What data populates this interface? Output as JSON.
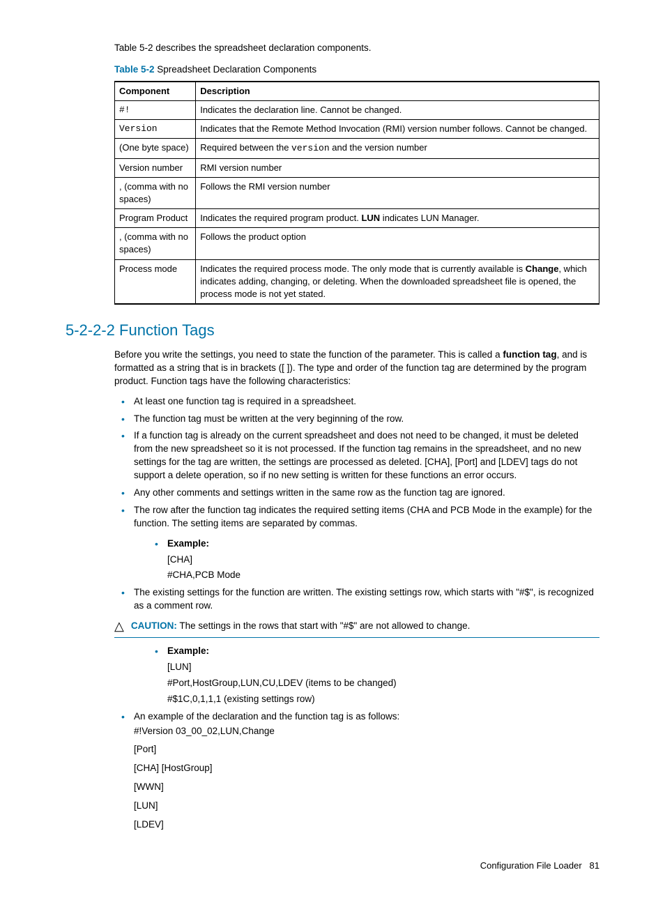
{
  "intro": "Table 5-2 describes the spreadsheet declaration components.",
  "tableCaption": {
    "ref": "Table 5-2",
    "title": " Spreadsheet Declaration Components"
  },
  "table": {
    "headers": [
      "Component",
      "Description"
    ],
    "rows": [
      {
        "c": "#!",
        "cMono": true,
        "d": "Indicates the declaration line. Cannot be changed."
      },
      {
        "c": "Version",
        "cMono": true,
        "d": "Indicates that the Remote Method Invocation (RMI) version number follows. Cannot be changed."
      },
      {
        "c": "(One byte space)",
        "dPre": "Required between the ",
        "dMono": "version",
        "dPost": " and the version number"
      },
      {
        "c": "Version number",
        "d": "RMI version number"
      },
      {
        "c": ", (comma with no spaces)",
        "d": "Follows the RMI version number"
      },
      {
        "c": "Program Product",
        "dPre": "Indicates the required program product. ",
        "dBold": "LUN",
        "dPost": " indicates LUN Manager."
      },
      {
        "c": ", (comma with no spaces)",
        "d": "Follows the product option"
      },
      {
        "c": "Process mode",
        "dPre": "Indicates the required process mode. The only mode that is currently available is ",
        "dBold": "Change",
        "dPost": ", which indicates adding, changing, or deleting. When the downloaded spreadsheet file is opened, the process mode is not yet stated."
      }
    ]
  },
  "section": {
    "heading": "5-2-2-2 Function Tags",
    "paraPre": "Before you write the settings, you need to state the function of the parameter. This is called a ",
    "paraBold": "function tag",
    "paraPost": ", and is formatted as a string that is in brackets ([ ]). The type and order of the function tag are determined by the program product. Function tags have the following characteristics:",
    "bullets1": [
      "At least one function tag is required in a spreadsheet.",
      "The function tag must be written at the very beginning of the row.",
      "If a function tag is already on the current spreadsheet and does not need to be changed, it must be deleted from the new spreadsheet so it is not processed. If the function tag remains in the spreadsheet, and no new settings for the tag are written, the settings are processed as deleted. [CHA], [Port] and [LDEV] tags do not support a delete operation, so if no new setting is written for these functions an error occurs.",
      "Any other comments and settings written in the same row as the function tag are ignored.",
      "The row after the function tag indicates the required setting items (CHA and PCB Mode in the example) for the function. The setting items are separated by commas."
    ],
    "example1": {
      "label": "Example:",
      "lines": [
        "[CHA]",
        "#CHA,PCB Mode"
      ]
    },
    "bullet2": "The existing settings for the function are written. The existing settings row, which starts with \"#$\", is recognized as a comment row.",
    "caution": {
      "label": "CAUTION:",
      "text": " The settings in the rows that start with \"#$\" are not allowed to change."
    },
    "example2": {
      "label": "Example:",
      "lines": [
        "[LUN]",
        "#Port,HostGroup,LUN,CU,LDEV (items to be changed)",
        "#$1C,0,1,1,1 (existing settings row)"
      ]
    },
    "bullet3": "An example of the declaration and the function tag is as follows:",
    "decl": [
      "#!Version 03_00_02,LUN,Change",
      "[Port]",
      "[CHA] [HostGroup]",
      "[WWN]",
      "[LUN]",
      "[LDEV]"
    ]
  },
  "footer": {
    "text": "Configuration File Loader",
    "page": "81"
  }
}
